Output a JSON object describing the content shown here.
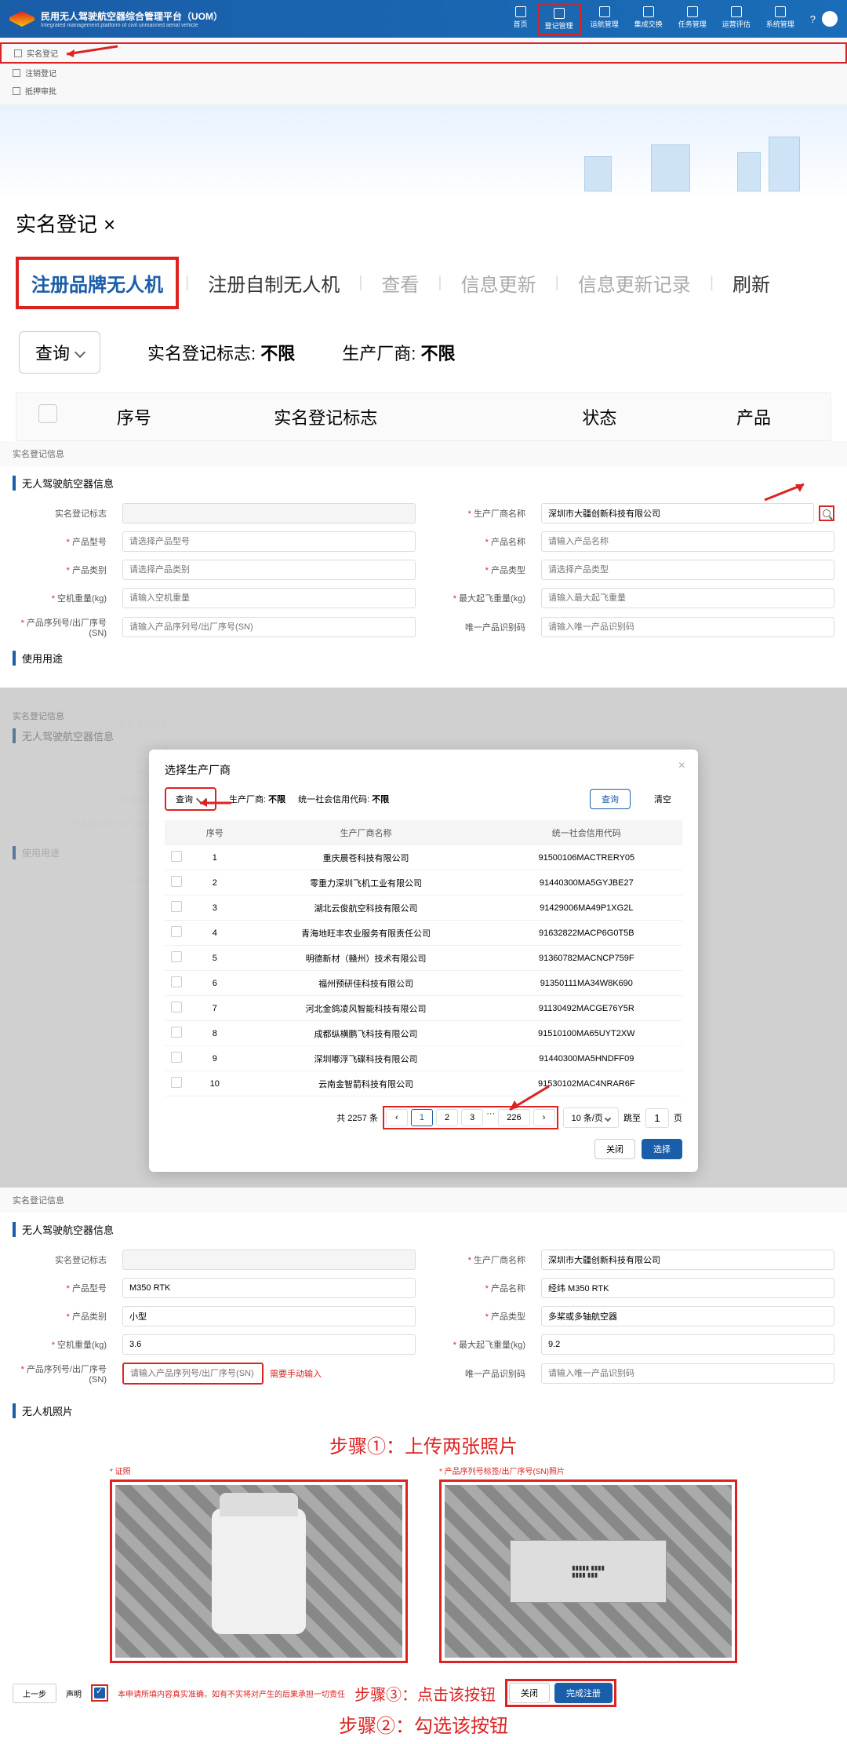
{
  "header": {
    "title": "民用无人驾驶航空器综合管理平台（UOM）",
    "subtitle": "Integrated management platform of civil unmanned aerial vehicle",
    "nav": [
      "首页",
      "登记管理",
      "运航管理",
      "集成交换",
      "任务管理",
      "运营评估",
      "系统管理"
    ],
    "active_nav_index": 1
  },
  "sidebar": {
    "items": [
      "实名登记",
      "注销登记",
      "抵押审批"
    ]
  },
  "page": {
    "title": "实名登记",
    "tabs": [
      "注册品牌无人机",
      "注册自制无人机",
      "查看",
      "信息更新",
      "信息更新记录",
      "刷新"
    ]
  },
  "filters": {
    "query": "查询",
    "label1": "实名登记标志:",
    "value1": "不限",
    "label2": "生产厂商:",
    "value2": "不限"
  },
  "table_head": [
    "序号",
    "实名登记标志",
    "状态",
    "产品"
  ],
  "section1": {
    "crumb": "实名登记信息",
    "title": "无人驾驶航空器信息",
    "fields": {
      "reg_mark": {
        "label": "实名登记标志",
        "placeholder": ""
      },
      "producer": {
        "label": "生产厂商名称",
        "value": "深圳市大疆创新科技有限公司"
      },
      "model": {
        "label": "产品型号",
        "placeholder": "请选择产品型号"
      },
      "name": {
        "label": "产品名称",
        "placeholder": "请输入产品名称"
      },
      "category": {
        "label": "产品类别",
        "placeholder": "请选择产品类别"
      },
      "type": {
        "label": "产品类型",
        "placeholder": "请选择产品类型"
      },
      "weight": {
        "label": "空机重量(kg)",
        "placeholder": "请输入空机重量"
      },
      "max_weight": {
        "label": "最大起飞重量(kg)",
        "placeholder": "请输入最大起飞重量"
      },
      "sn": {
        "label": "产品序列号/出厂序号(SN)",
        "placeholder": "请输入产品序列号/出厂序号(SN)"
      },
      "uid": {
        "label": "唯一产品识别码",
        "placeholder": "请输入唯一产品识别码"
      }
    },
    "usage": "使用用途"
  },
  "modal": {
    "title": "选择生产厂商",
    "query": "查询",
    "filter1_label": "生产厂商:",
    "filter1_value": "不限",
    "filter2_label": "统一社会信用代码:",
    "filter2_value": "不限",
    "search_btn": "查询",
    "clear_btn": "清空",
    "headers": [
      "序号",
      "生产厂商名称",
      "统一社会信用代码"
    ],
    "rows": [
      {
        "idx": "1",
        "name": "重庆晨苍科技有限公司",
        "code": "91500106MACTRERY05"
      },
      {
        "idx": "2",
        "name": "零重力深圳飞机工业有限公司",
        "code": "91440300MA5GYJBE27"
      },
      {
        "idx": "3",
        "name": "湖北云俊航空科技有限公司",
        "code": "91429006MA49P1XG2L"
      },
      {
        "idx": "4",
        "name": "青海地旺丰农业服务有限责任公司",
        "code": "91632822MACP6G0T5B"
      },
      {
        "idx": "5",
        "name": "明德新材（赣州）技术有限公司",
        "code": "91360782MACNCP759F"
      },
      {
        "idx": "6",
        "name": "福州预研佳科技有限公司",
        "code": "91350111MA34W8K690"
      },
      {
        "idx": "7",
        "name": "河北金鸽凌风智能科技有限公司",
        "code": "91130492MACGE76Y5R"
      },
      {
        "idx": "8",
        "name": "成都纵横鹏飞科技有限公司",
        "code": "91510100MA65UYT2XW"
      },
      {
        "idx": "9",
        "name": "深圳嘟浮飞碟科技有限公司",
        "code": "91440300MA5HNDFF09"
      },
      {
        "idx": "10",
        "name": "云南金智箭科技有限公司",
        "code": "91530102MAC4NRAR6F"
      }
    ],
    "total": "共 2257 条",
    "pages": [
      "1",
      "2",
      "3"
    ],
    "last_page": "226",
    "per_page": "10 条/页",
    "jump_label": "跳至",
    "jump_val": "1",
    "page_suffix": "页",
    "close": "关闭",
    "select": "选择"
  },
  "modal_bg": {
    "crumb": "实名登记信息",
    "title": "无人驾驶航空器信息",
    "labels": [
      "实名登记标志",
      "* 产品型号",
      "* 产品类别",
      "* 空机重量(kg)",
      "* 产品序列号/出厂序号(SN)"
    ],
    "usage": "使用用途",
    "usage_sub": "* 使用用途"
  },
  "section3": {
    "crumb": "实名登记信息",
    "title": "无人驾驶航空器信息",
    "reg_mark_label": "实名登记标志",
    "producer_label": "生产厂商名称",
    "producer_value": "深圳市大疆创新科技有限公司",
    "model_label": "产品型号",
    "model_value": "M350 RTK",
    "name_label": "产品名称",
    "name_value": "经纬 M350 RTK",
    "category_label": "产品类别",
    "category_value": "小型",
    "type_label": "产品类型",
    "type_value": "多桨或多轴航空器",
    "weight_label": "空机重量(kg)",
    "weight_value": "3.6",
    "max_weight_label": "最大起飞重量(kg)",
    "max_weight_value": "9.2",
    "sn_label": "产品序列号/出厂序号(SN)",
    "sn_placeholder": "请输入产品序列号/出厂序号(SN)",
    "sn_note": "需要手动输入",
    "uid_label": "唯一产品识别码",
    "uid_placeholder": "请输入唯一产品识别码"
  },
  "photos": {
    "section_title": "无人机照片",
    "step1": "步骤①：上传两张照片",
    "label_left": "* 证照",
    "label_right": "* 产品序列号标签/出厂序号(SN)照片",
    "step2": "步骤②：勾选该按钮",
    "step3": "步骤③：点击该按钮",
    "prev": "上一步",
    "declare_label": "声明",
    "declare_text": "本申请所填内容真实准确，如有不实将对产生的后果承担一切责任",
    "close": "关闭",
    "submit": "完成注册"
  }
}
